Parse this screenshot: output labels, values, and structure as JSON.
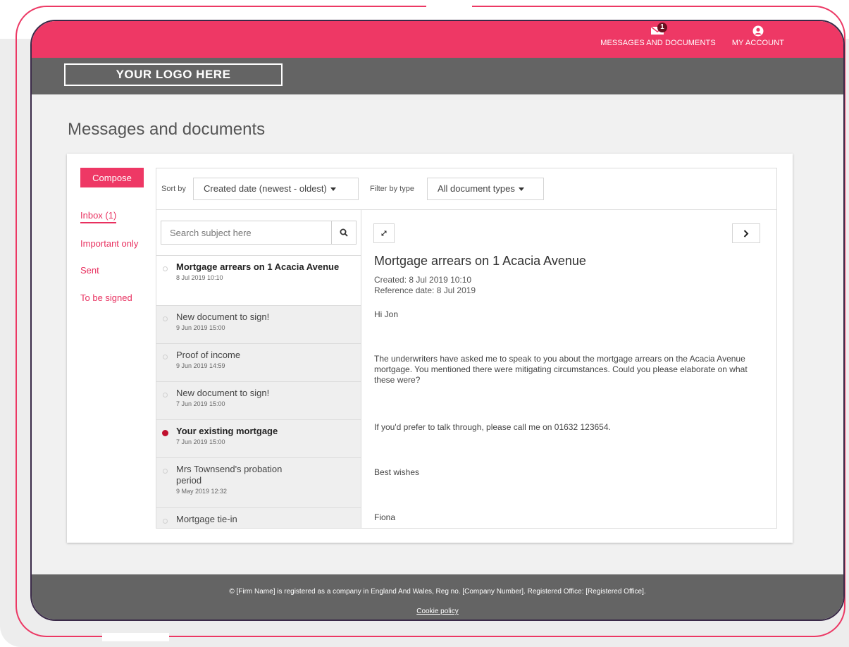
{
  "colors": {
    "brand": "#ee3865",
    "header_gray": "#646464",
    "unread_dot": "#c0102e",
    "badge": "#6b0f1f"
  },
  "nav": {
    "messages": {
      "icon": "envelope-icon",
      "label": "MESSAGES AND DOCUMENTS",
      "badge": "1"
    },
    "account": {
      "icon": "user-circle-icon",
      "label": "MY ACCOUNT"
    }
  },
  "logo": {
    "text": "YOUR LOGO HERE"
  },
  "page": {
    "title": "Messages and documents"
  },
  "sidebar": {
    "compose_label": "Compose",
    "folders": [
      {
        "label": "Inbox (1)",
        "active": true
      },
      {
        "label": "Important only"
      },
      {
        "label": "Sent"
      },
      {
        "label": "To be signed"
      }
    ]
  },
  "toolbar": {
    "sort_label": "Sort by",
    "sort_value": "Created date (newest - oldest)",
    "filter_label": "Filter by type",
    "filter_value": "All document types"
  },
  "search": {
    "placeholder": "Search subject here",
    "icon": "search-icon"
  },
  "messages": [
    {
      "subject": "Mortgage arrears on 1 Acacia Avenue",
      "date": "8 Jul 2019 10:10",
      "selected": true,
      "bold": true,
      "unread": false
    },
    {
      "subject": "New document to sign!",
      "date": "9 Jun 2019 15:00"
    },
    {
      "subject": "Proof of income",
      "date": "9 Jun 2019 14:59"
    },
    {
      "subject": "New document to sign!",
      "date": "7 Jun 2019 15:00"
    },
    {
      "subject": "Your existing mortgage",
      "date": "7 Jun 2019 15:00",
      "bold": true,
      "unread": true
    },
    {
      "subject": "Mrs Townsend's probation period",
      "date": "9 May 2019 12:32"
    },
    {
      "subject": "Mortgage tie-in",
      "date": ""
    }
  ],
  "reader": {
    "expand_icon": "expand-icon",
    "next_icon": "chevron-right-icon",
    "title": "Mortgage arrears on 1 Acacia Avenue",
    "created": "Created: 8 Jul 2019 10:10",
    "reference": "Reference date: 8 Jul 2019",
    "greeting": "Hi Jon",
    "para1": "The underwriters have asked me to speak to you about the mortgage arrears on the Acacia Avenue mortgage.  You mentioned there were mitigating circumstances. Could you please elaborate on what these were?",
    "para2": "If you'd prefer to talk through, please call me on 01632 123654.",
    "signoff": "Best wishes",
    "signature": "Fiona"
  },
  "footer": {
    "copyright": "© [Firm Name] is registered as a company in England And Wales, Reg no. [Company Number]. Registered Office: [Registered Office].",
    "cookie": "Cookie policy"
  }
}
